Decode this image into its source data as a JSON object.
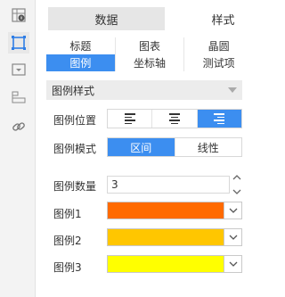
{
  "tabs": [
    {
      "label": "数据"
    },
    {
      "label": "样式"
    }
  ],
  "subtabs_row1": [
    "标题",
    "图表",
    "晶圆"
  ],
  "subtabs_row2": [
    "图例",
    "坐标轴",
    "测试项"
  ],
  "section": {
    "title": "图例样式"
  },
  "legend_position": {
    "label": "图例位置",
    "options": [
      "left-align-icon",
      "center-align-icon",
      "right-align-icon"
    ],
    "selected": "right-align-icon"
  },
  "legend_mode": {
    "label": "图例模式",
    "options": [
      "区间",
      "线性"
    ],
    "selected": "区间"
  },
  "legend_count": {
    "label": "图例数量",
    "value": "3"
  },
  "legends": [
    {
      "label": "图例1",
      "color": "#ff6a00"
    },
    {
      "label": "图例2",
      "color": "#ffc600"
    },
    {
      "label": "图例3",
      "color": "#ffff00"
    }
  ],
  "colors": {
    "accent": "#3c8ef0"
  }
}
